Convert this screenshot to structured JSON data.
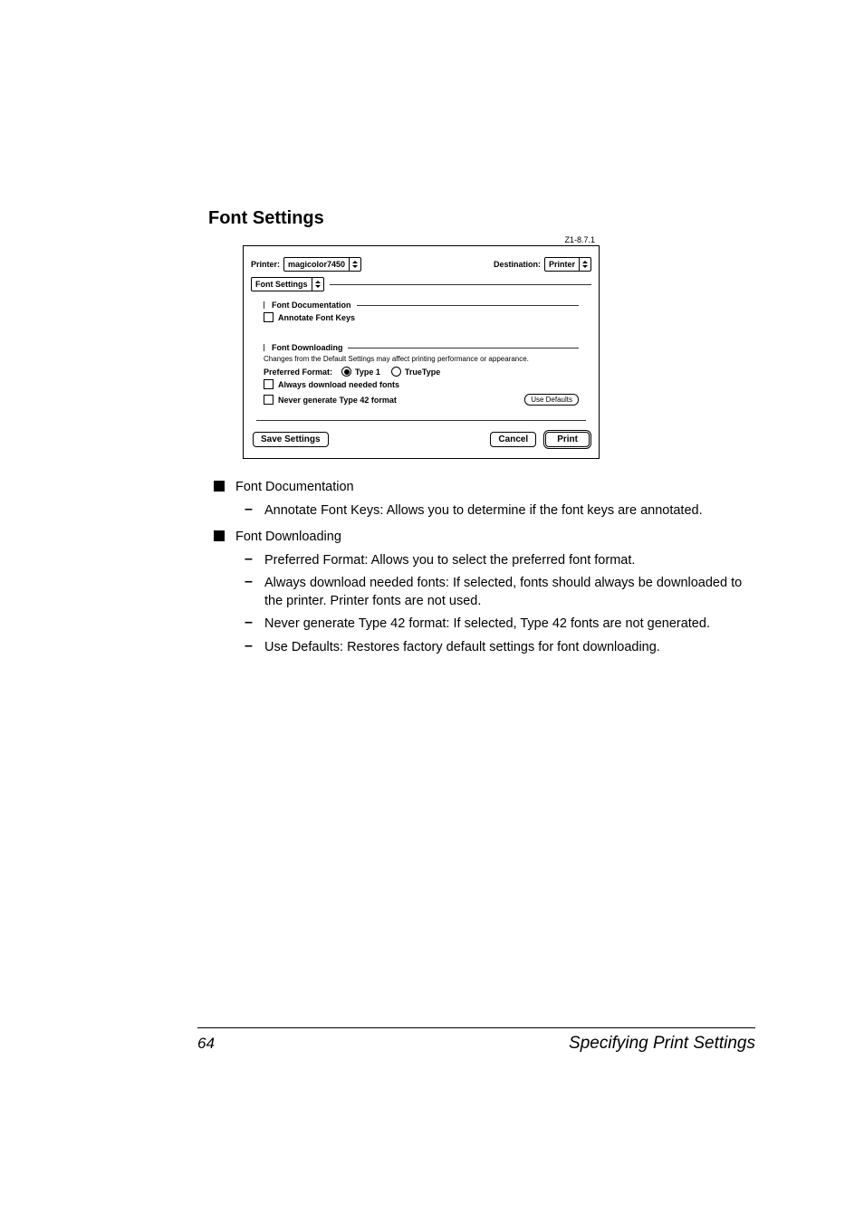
{
  "section_title": "Font Settings",
  "dialog": {
    "version": "Z1-8.7.1",
    "printer_label": "Printer:",
    "printer_value": "magicolor7450",
    "destination_label": "Destination:",
    "destination_value": "Printer",
    "panel_value": "Font Settings",
    "group1": {
      "title": "Font Documentation",
      "annotate": "Annotate Font Keys"
    },
    "group2": {
      "title": "Font Downloading",
      "note": "Changes from the Default Settings may affect printing performance or appearance.",
      "preferred_label": "Preferred Format:",
      "opt_type1": "Type 1",
      "opt_truetype": "TrueType",
      "always_dl": "Always download needed fonts",
      "never_42": "Never generate Type 42 format",
      "use_defaults": "Use Defaults"
    },
    "save": "Save Settings",
    "cancel": "Cancel",
    "print": "Print"
  },
  "body": {
    "b1": "Font Documentation",
    "b1a": "Annotate Font Keys: Allows you to determine if the font keys are anno­tated.",
    "b2": "Font Downloading",
    "b2a": "Preferred Format: Allows you to select the preferred font format.",
    "b2b": "Always download needed fonts: If selected, fonts should always be downloaded to the printer. Printer fonts are not used.",
    "b2c": "Never generate Type 42 format: If selected, Type 42 fonts are not gen­erated.",
    "b2d": "Use Defaults: Restores factory default settings for font downloading."
  },
  "footer": {
    "page": "64",
    "title": "Specifying Print Settings"
  }
}
